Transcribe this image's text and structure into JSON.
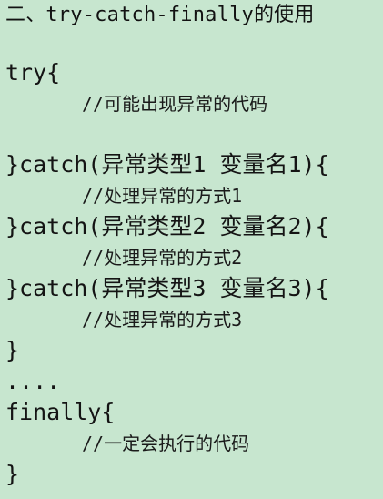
{
  "heading": "二、try-catch-finally的使用",
  "code_lines": [
    "try{",
    "//可能出现异常的代码",
    "",
    "}catch(异常类型1 变量名1){",
    "//处理异常的方式1",
    "}catch(异常类型2 变量名2){",
    "//处理异常的方式2",
    "}catch(异常类型3 变量名3){",
    "//处理异常的方式3",
    "}",
    "....",
    "finally{",
    "//一定会执行的代码",
    "}"
  ]
}
